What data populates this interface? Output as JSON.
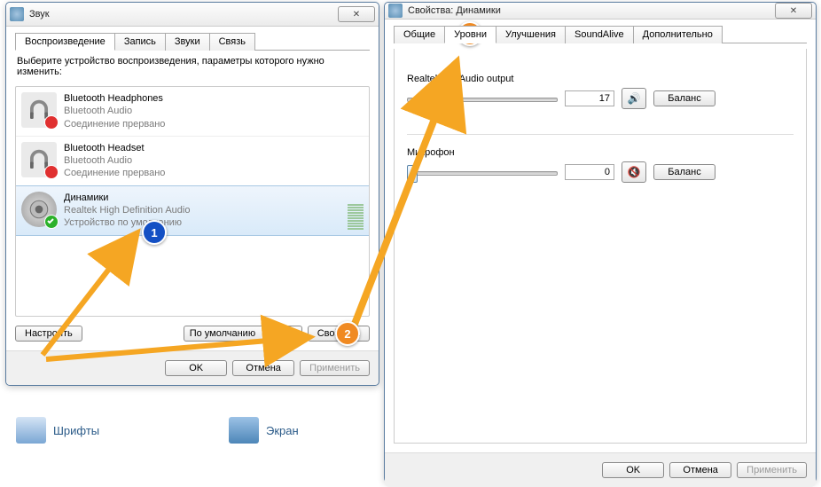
{
  "win1": {
    "title": "Звук",
    "tabs": [
      "Воспроизведение",
      "Запись",
      "Звуки",
      "Связь"
    ],
    "active_tab": 0,
    "instruction": "Выберите устройство воспроизведения, параметры которого нужно изменить:",
    "devices": [
      {
        "name": "Bluetooth Headphones",
        "sub1": "Bluetooth Audio",
        "sub2": "Соединение прервано",
        "status": "error"
      },
      {
        "name": "Bluetooth Headset",
        "sub1": "Bluetooth Audio",
        "sub2": "Соединение прервано",
        "status": "error"
      },
      {
        "name": "Динамики",
        "sub1": "Realtek High Definition Audio",
        "sub2": "Устройство по умолчанию",
        "status": "ok",
        "selected": true
      }
    ],
    "btn_configure": "Настроить",
    "combo_default": "По умолчанию",
    "btn_properties": "Свойства",
    "btn_ok": "OK",
    "btn_cancel": "Отмена",
    "btn_apply": "Применить"
  },
  "win2": {
    "title": "Свойства: Динамики",
    "tabs": [
      "Общие",
      "Уровни",
      "Улучшения",
      "SoundAlive",
      "Дополнительно"
    ],
    "active_tab": 1,
    "levels": [
      {
        "label": "Realtek HD Audio output",
        "value": "17",
        "muted": false,
        "pos_pct": 17
      },
      {
        "label": "Микрофон",
        "value": "0",
        "muted": true,
        "pos_pct": 0
      }
    ],
    "btn_balance": "Баланс",
    "btn_ok": "OK",
    "btn_cancel": "Отмена",
    "btn_apply": "Применить"
  },
  "desktop": {
    "fonts": "Шрифты",
    "screen": "Экран"
  },
  "annotations": {
    "a1": "1",
    "a2": "2",
    "a3": "3"
  }
}
